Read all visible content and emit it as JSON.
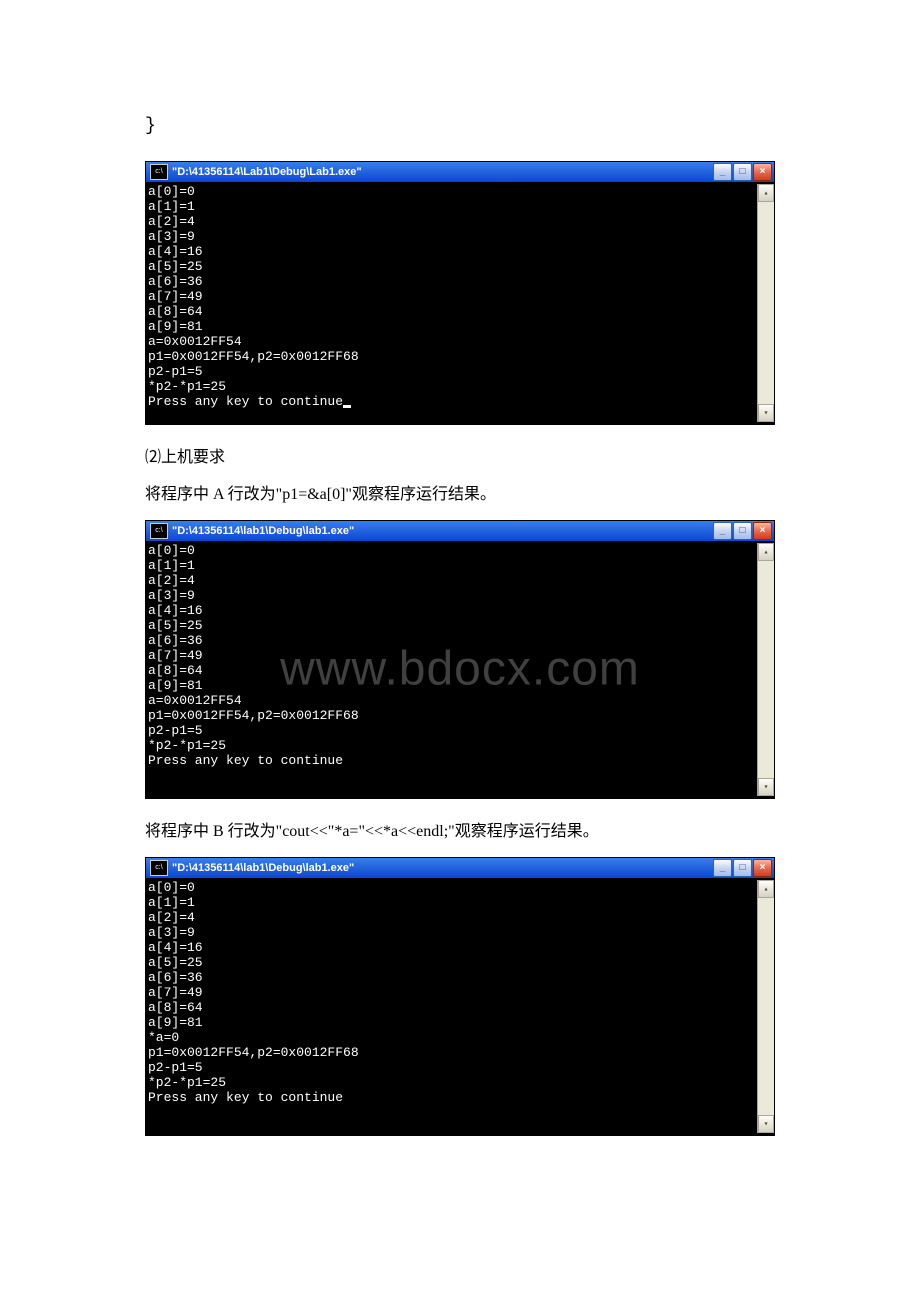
{
  "text": {
    "brace": "}",
    "section2": "⑵上机要求",
    "instrA": "将程序中 A 行改为\"p1=&a[0]\"观察程序运行结果。",
    "instrB": "将程序中 B 行改为\"cout<<\"*a=\"<<*a<<endl;\"观察程序运行结果。"
  },
  "watermark": "www.bdocx.com",
  "console1": {
    "title": "\"D:\\41356114\\Lab1\\Debug\\Lab1.exe\"",
    "icon": "c:\\",
    "lines": "a[0]=0\na[1]=1\na[2]=4\na[3]=9\na[4]=16\na[5]=25\na[6]=36\na[7]=49\na[8]=64\na[9]=81\na=0x0012FF54\np1=0x0012FF54,p2=0x0012FF68\np2-p1=5\n*p2-*p1=25\nPress any key to continue"
  },
  "console2": {
    "title": "\"D:\\41356114\\lab1\\Debug\\lab1.exe\"",
    "icon": "c:\\",
    "lines": "a[0]=0\na[1]=1\na[2]=4\na[3]=9\na[4]=16\na[5]=25\na[6]=36\na[7]=49\na[8]=64\na[9]=81\na=0x0012FF54\np1=0x0012FF54,p2=0x0012FF68\np2-p1=5\n*p2-*p1=25\nPress any key to continue\n"
  },
  "console3": {
    "title": "\"D:\\41356114\\lab1\\Debug\\lab1.exe\"",
    "icon": "c:\\",
    "lines": "a[0]=0\na[1]=1\na[2]=4\na[3]=9\na[4]=16\na[5]=25\na[6]=36\na[7]=49\na[8]=64\na[9]=81\n*a=0\np1=0x0012FF54,p2=0x0012FF68\np2-p1=5\n*p2-*p1=25\nPress any key to continue\n"
  },
  "winbuttons": {
    "min": "_",
    "max": "□",
    "close": "×"
  },
  "scroll": {
    "up": "▴",
    "down": "▾"
  }
}
